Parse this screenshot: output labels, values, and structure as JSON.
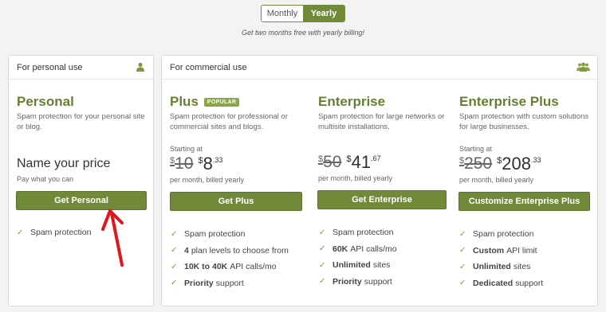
{
  "billing": {
    "monthly_label": "Monthly",
    "yearly_label": "Yearly",
    "selected": "Yearly",
    "note": "Get two months free with yearly billing!"
  },
  "personal_panel": {
    "header": "For personal use",
    "icon": "user-icon",
    "plan": {
      "name": "Personal",
      "description": "Spam protection for your personal site or blog.",
      "price_heading": "Name your price",
      "price_sub": "Pay what you can",
      "button": "Get Personal",
      "features": [
        "Spam protection"
      ]
    }
  },
  "commercial_panel": {
    "header": "For commercial use",
    "icon": "users-icon",
    "plans": [
      {
        "name": "Plus",
        "badge": "POPULAR",
        "description": "Spam protection for professional or commercial sites and blogs.",
        "starting": "Starting at",
        "currency": "$",
        "old_price": "10",
        "new_price": "8",
        "cents": ".33",
        "per": "per month, billed yearly",
        "button": "Get Plus",
        "features": [
          {
            "bold": "",
            "text": "Spam protection"
          },
          {
            "bold": "4",
            "text": "plan levels to choose from"
          },
          {
            "bold": "10K to 40K",
            "text": "API calls/mo"
          },
          {
            "bold": "Priority",
            "text": "support"
          }
        ]
      },
      {
        "name": "Enterprise",
        "badge": "",
        "description": "Spam protection for large networks or multisite installations.",
        "starting": "",
        "currency": "$",
        "old_price": "50",
        "new_price": "41",
        "cents": ".67",
        "per": "per month, billed yearly",
        "button": "Get Enterprise",
        "features": [
          {
            "bold": "",
            "text": "Spam protection"
          },
          {
            "bold": "60K",
            "text": "API calls/mo"
          },
          {
            "bold": "Unlimited",
            "text": "sites"
          },
          {
            "bold": "Priority",
            "text": "support"
          }
        ]
      },
      {
        "name": "Enterprise Plus",
        "badge": "",
        "description": "Spam protection with custom solutions for large businesses.",
        "starting": "Starting at",
        "currency": "$",
        "old_price": "250",
        "new_price": "208",
        "cents": ".33",
        "per": "per month, billed yearly",
        "button": "Customize Enterprise Plus",
        "features": [
          {
            "bold": "",
            "text": "Spam protection"
          },
          {
            "bold": "Custom",
            "text": "API limit"
          },
          {
            "bold": "Unlimited",
            "text": "sites"
          },
          {
            "bold": "Dedicated",
            "text": "support"
          }
        ]
      }
    ]
  },
  "annotation": {
    "color": "#e0161c"
  },
  "colors": {
    "accent": "#718a3a",
    "heading": "#667f32"
  }
}
